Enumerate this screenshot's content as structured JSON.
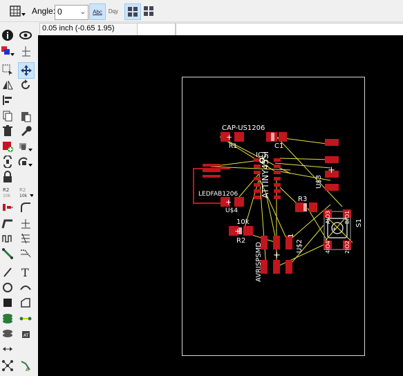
{
  "toolbar": {
    "grid_icon": "grid-icon",
    "angle_label": "Angle:",
    "angle_value": "0",
    "text_style_1": "Abc",
    "text_style_2": "Dqy"
  },
  "coords": {
    "display": "0.05 inch (-0.65 1.95)"
  },
  "board": {
    "labels": {
      "cap": "CAP-US1206",
      "c1": "C1",
      "ic1": "IC1",
      "r1": "R1",
      "attiny": "ATTINY45SI",
      "ledfab": "LEDFAB1206",
      "u4": "U$4",
      "u3": "U$3",
      "r3": "R3",
      "r2": "R2",
      "tenk": "10k",
      "s1": "S1",
      "avr": "AVRISPSMD",
      "u2": "U$2",
      "one": "1",
      "pin_ul": "AIO3",
      "pin_ur": "BIO1",
      "pin_ll": "4IO4",
      "pin_lr": "2IO2"
    }
  },
  "colors": {
    "canvas": "#000000",
    "pad": "#c0161e",
    "pad_light": "#e8a8a8",
    "airwire": "#e8e040",
    "outline": "#ffffff",
    "accent": "#cce4f7"
  }
}
